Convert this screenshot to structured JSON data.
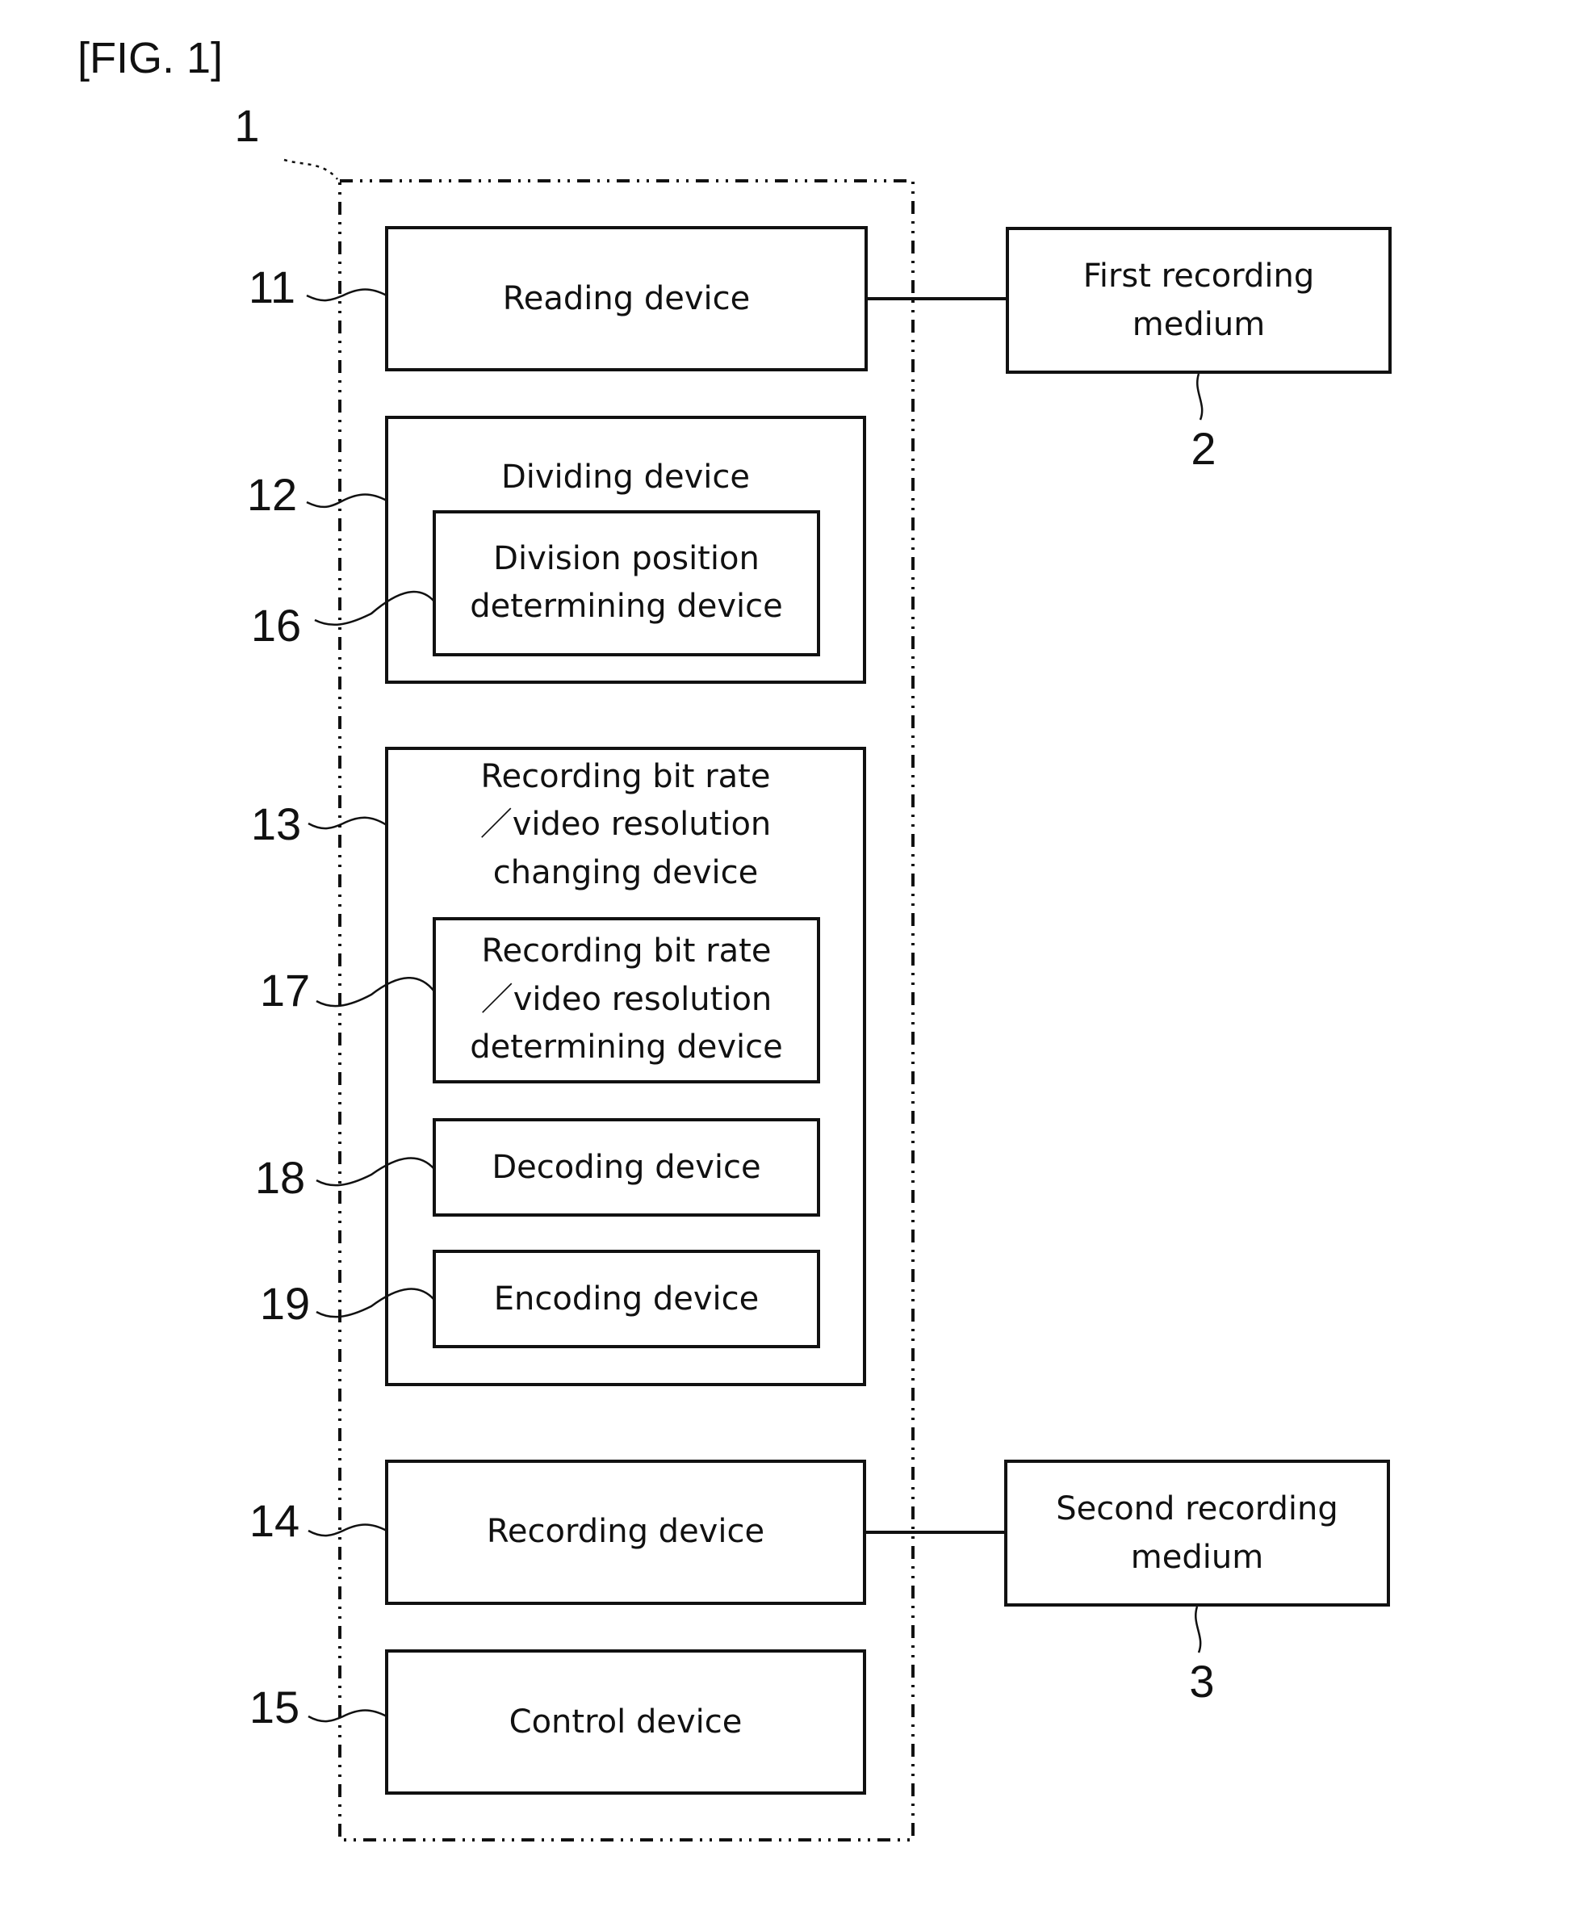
{
  "figure_label": "[FIG. 1]",
  "system": {
    "ref": "1"
  },
  "blocks": [
    {
      "id": "reading",
      "ref": "11",
      "lines": [
        "Reading device"
      ]
    },
    {
      "id": "dividing",
      "ref": "12",
      "lines": [
        "Dividing device"
      ]
    },
    {
      "id": "division-position",
      "ref": "16",
      "lines": [
        "Division position",
        "determining device"
      ]
    },
    {
      "id": "changing",
      "ref": "13",
      "lines": [
        "Recording bit rate",
        "／video resolution",
        "changing device"
      ]
    },
    {
      "id": "determining",
      "ref": "17",
      "lines": [
        "Recording bit rate",
        "／video resolution",
        "determining device"
      ]
    },
    {
      "id": "decoding",
      "ref": "18",
      "lines": [
        "Decoding device"
      ]
    },
    {
      "id": "encoding",
      "ref": "19",
      "lines": [
        "Encoding device"
      ]
    },
    {
      "id": "recording",
      "ref": "14",
      "lines": [
        "Recording device"
      ]
    },
    {
      "id": "control",
      "ref": "15",
      "lines": [
        "Control device"
      ]
    }
  ],
  "external": [
    {
      "id": "first-medium",
      "ref": "2",
      "lines": [
        "First recording",
        "medium"
      ]
    },
    {
      "id": "second-medium",
      "ref": "3",
      "lines": [
        "Second recording",
        "medium"
      ]
    }
  ]
}
